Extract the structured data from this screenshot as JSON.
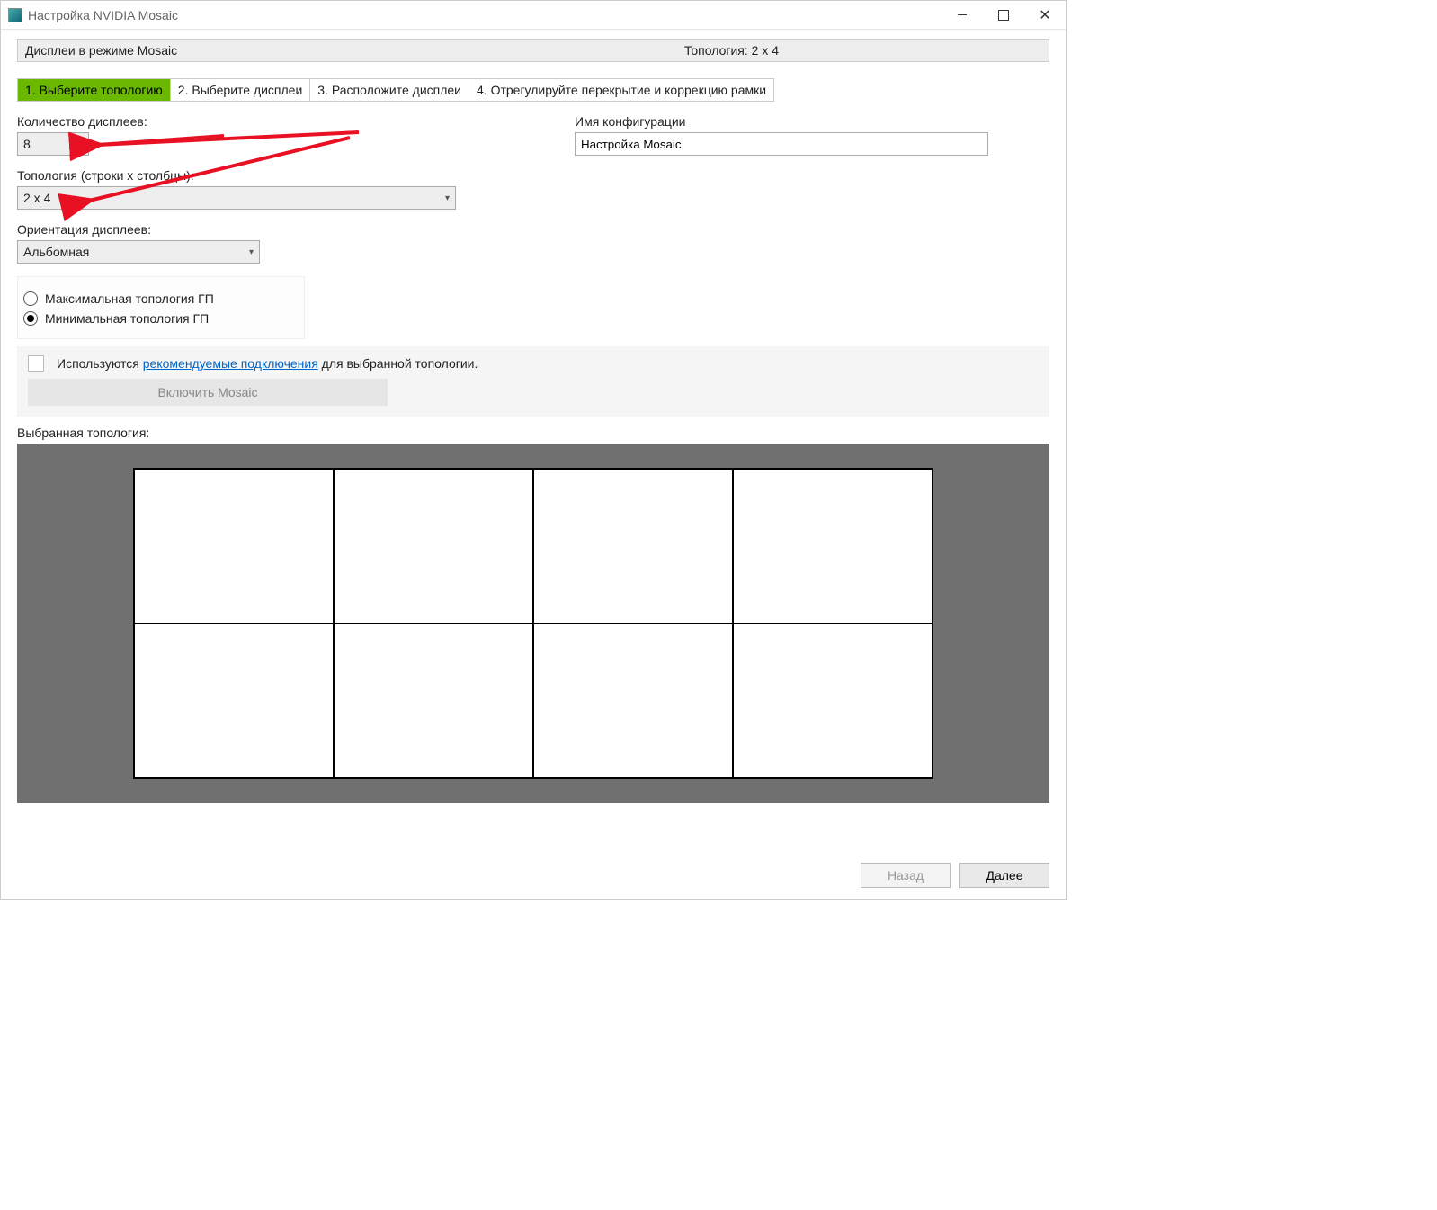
{
  "window": {
    "title": "Настройка NVIDIA Mosaic"
  },
  "header": {
    "mode_label": "Дисплеи в режиме Mosaic",
    "topology_label": "Топология: 2 x 4"
  },
  "tabs": [
    {
      "label": "1. Выберите топологию",
      "active": true
    },
    {
      "label": "2. Выберите дисплеи",
      "active": false
    },
    {
      "label": "3. Расположите дисплеи",
      "active": false
    },
    {
      "label": "4. Отрегулируйте перекрытие и коррекцию рамки",
      "active": false
    }
  ],
  "fields": {
    "display_count": {
      "label": "Количество дисплеев:",
      "value": "8"
    },
    "topology": {
      "label": "Топология (строки x столбцы):",
      "value": "2 x 4"
    },
    "orientation": {
      "label": "Ориентация дисплеев:",
      "value": "Альбомная"
    },
    "config_name": {
      "label": "Имя конфигурации",
      "value": "Настройка Mosaic"
    }
  },
  "radio": {
    "max": "Максимальная топология ГП",
    "min": "Минимальная топология ГП",
    "selected": "min"
  },
  "enable_panel": {
    "prefix": "Используются ",
    "link": "рекомендуемые подключения",
    "suffix": " для выбранной топологии.",
    "button": "Включить Mosaic"
  },
  "selected_topology_label": "Выбранная топология:",
  "grid": {
    "rows": 2,
    "cols": 4
  },
  "footer": {
    "back": "Назад",
    "next": "Далее"
  }
}
